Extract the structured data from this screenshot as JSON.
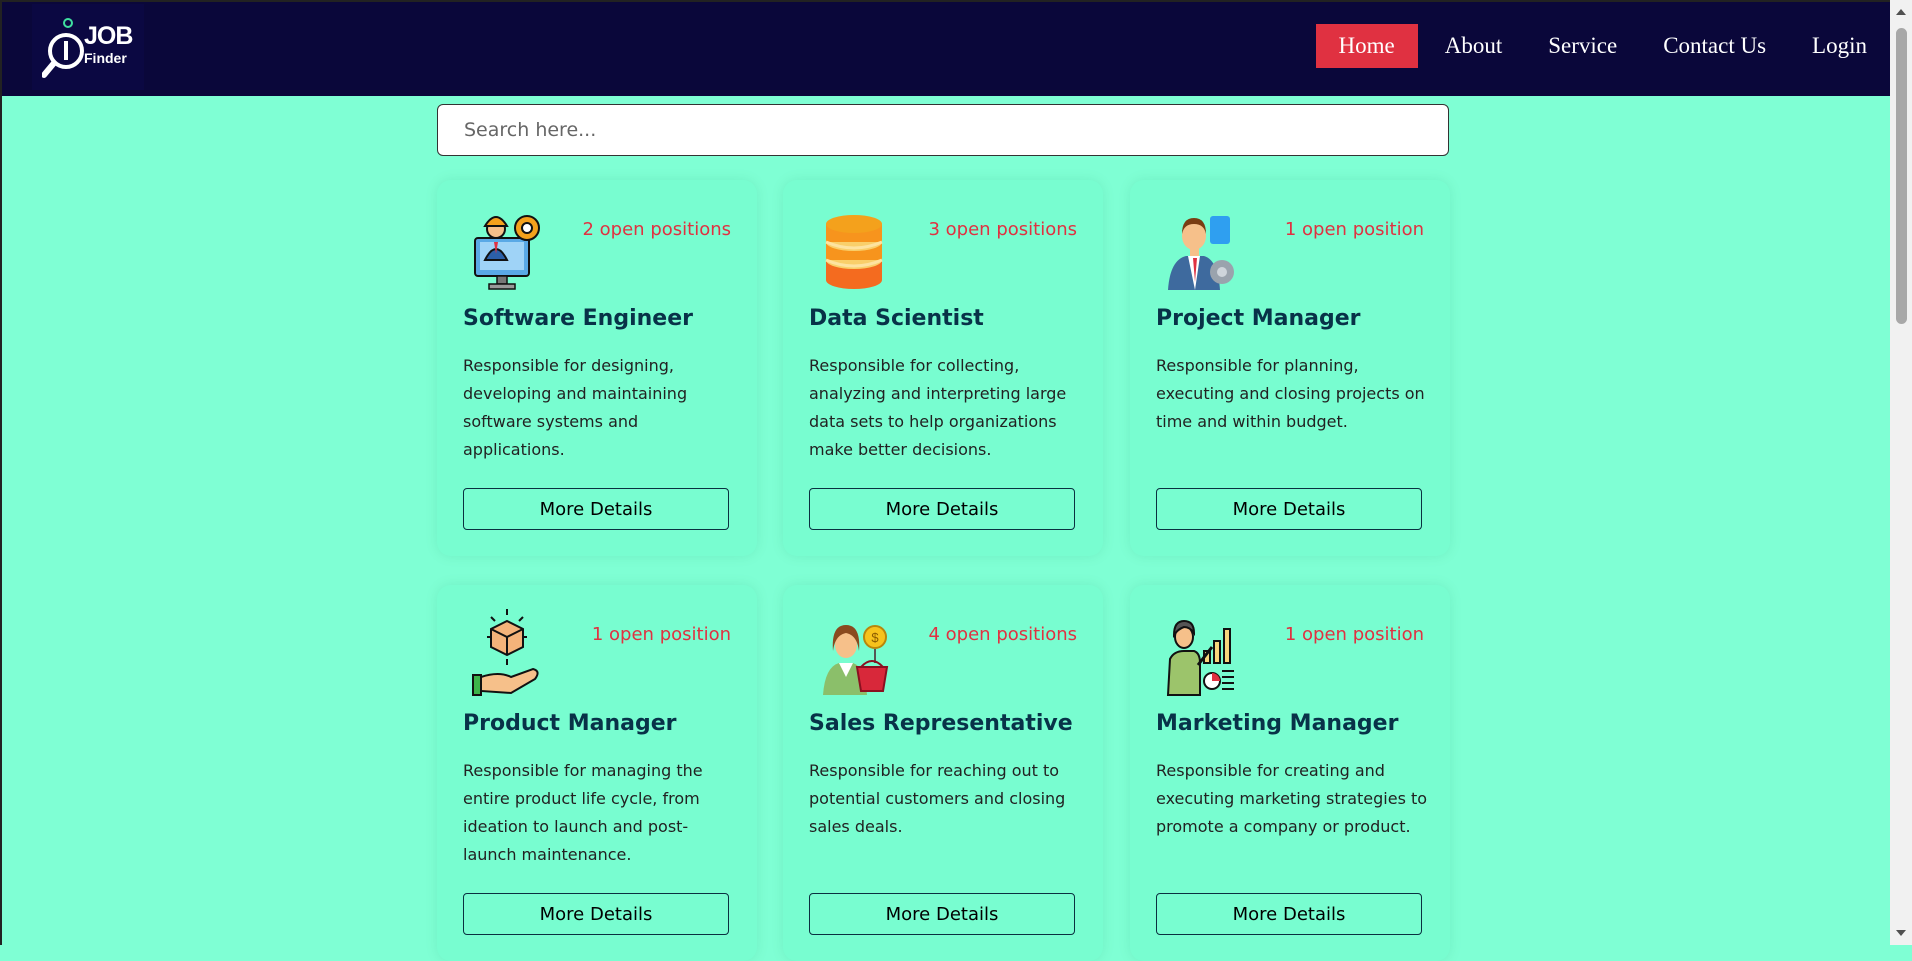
{
  "brand": {
    "line1": "JOB",
    "line2": "Finder"
  },
  "nav": {
    "home": "Home",
    "about": "About",
    "service": "Service",
    "contact": "Contact Us",
    "login": "Login"
  },
  "search": {
    "placeholder": "Search here..."
  },
  "colors": {
    "accent": "#e03141",
    "navbar": "#0a073a",
    "background": "#7fffd4",
    "title": "#083248"
  },
  "jobs": [
    {
      "icon": "engineer-icon",
      "positions": "2 open positions",
      "title": "Software Engineer",
      "desc": "Responsible for designing, developing and maintaining software systems and applications.",
      "button": "More Details"
    },
    {
      "icon": "database-icon",
      "positions": "3 open positions",
      "title": "Data Scientist",
      "desc": "Responsible for collecting, analyzing and interpreting large data sets to help organizations make better decisions.",
      "button": "More Details"
    },
    {
      "icon": "manager-icon",
      "positions": "1 open position",
      "title": "Project Manager",
      "desc": "Responsible for planning, executing and closing projects on time and within budget.",
      "button": "More Details"
    },
    {
      "icon": "product-hand-icon",
      "positions": "1 open position",
      "title": "Product Manager",
      "desc": "Responsible for managing the entire product life cycle, from ideation to launch and post-launch maintenance.",
      "button": "More Details"
    },
    {
      "icon": "sales-woman-icon",
      "positions": "4 open positions",
      "title": "Sales Representative",
      "desc": "Responsible for reaching out to potential customers and closing sales deals.",
      "button": "More Details"
    },
    {
      "icon": "marketing-chart-icon",
      "positions": "1 open position",
      "title": "Marketing Manager",
      "desc": "Responsible for creating and executing marketing strategies to promote a company or product.",
      "button": "More Details"
    }
  ]
}
